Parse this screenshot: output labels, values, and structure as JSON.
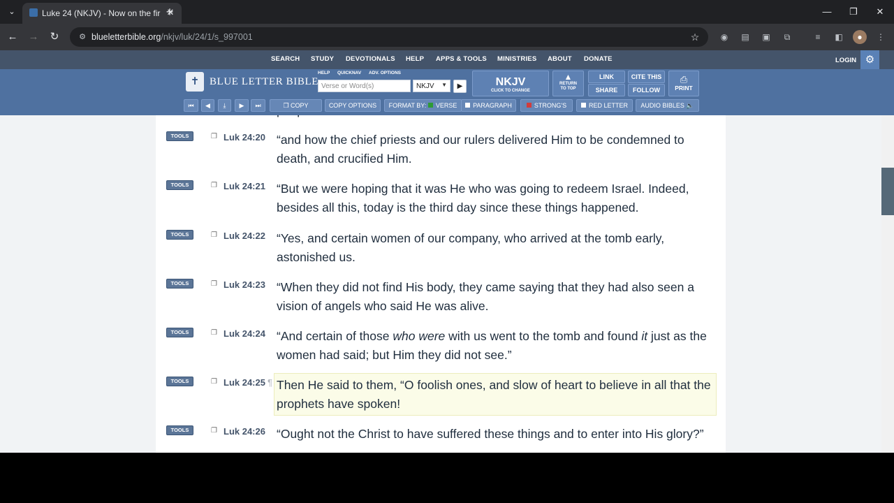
{
  "browser": {
    "tab_title": "Luke 24 (NKJV) - Now on the fir",
    "tab_close": "✕",
    "new_tab": "+",
    "url_domain": "blueletterbible.org",
    "url_path": "/nkjv/luk/24/1/s_997001",
    "icons": [
      "back-icon",
      "forward-icon",
      "reload-icon",
      "site-info-icon",
      "star-icon",
      "extensions-icon",
      "profile-icon",
      "menu-icon"
    ]
  },
  "site": {
    "nav": [
      "SEARCH",
      "STUDY",
      "DEVOTIONALS",
      "HELP",
      "APPS & TOOLS",
      "MINISTRIES",
      "ABOUT",
      "DONATE"
    ],
    "login": "LOGIN",
    "logo": "BLUE LETTER BIBLE",
    "search_labels": [
      "HELP",
      "QUICKNAV",
      "ADV. OPTIONS"
    ],
    "search_placeholder": "Verse or Word(s)",
    "version": "NKJV",
    "version_big": "NKJV",
    "version_sub": "CLICK TO CHANGE",
    "return_top_1": "RETURN",
    "return_top_2": "TO TOP",
    "link": "LINK",
    "share": "SHARE",
    "cite": "CITE THIS",
    "follow": "FOLLOW",
    "print": "PRINT",
    "toolbar": {
      "copy": "COPY",
      "copy_options": "COPY OPTIONS",
      "format_by": "FORMAT BY:",
      "verse": "VERSE",
      "paragraph": "PARAGRAPH",
      "strongs": "STRONG'S",
      "red_letter": "RED LETTER",
      "audio": "AUDIO BIBLES"
    },
    "colors": {
      "nav_bg": "#44546a",
      "header_bg": "#4f71a0",
      "accent": "#5a81b6",
      "highlight": "#fbfce8"
    }
  },
  "verses": [
    {
      "ref": "Luk 24:20",
      "text": "“and how the chief priests and our rulers delivered Him to be condemned to death, and crucified Him."
    },
    {
      "ref": "Luk 24:21",
      "text": "“But we were hoping that it was He who was going to redeem Israel. Indeed, besides all this, today is the third day since these things happened."
    },
    {
      "ref": "Luk 24:22",
      "text": "“Yes, and certain women of our company, who arrived at the tomb early, astonished us."
    },
    {
      "ref": "Luk 24:23",
      "text": "“When they did not find His body, they came saying that they had also seen a vision of angels who said He was alive."
    },
    {
      "ref": "Luk 24:24",
      "text_a": "“And certain of those ",
      "ital_a": "who were",
      "text_b": " with us went to the tomb and found ",
      "ital_b": "it",
      "text_c": " just as the women had said; but Him they did not see.”"
    },
    {
      "ref": "Luk 24:25",
      "text": "Then He said to them, “O foolish ones, and slow of heart to believe in all that the prophets have spoken!"
    },
    {
      "ref": "Luk 24:26",
      "text": "“Ought not the Christ to have suffered these things and to enter into His glory?”"
    }
  ],
  "tools_label": "TOOLS",
  "pilcrow": "¶",
  "partial_top_text": "people"
}
